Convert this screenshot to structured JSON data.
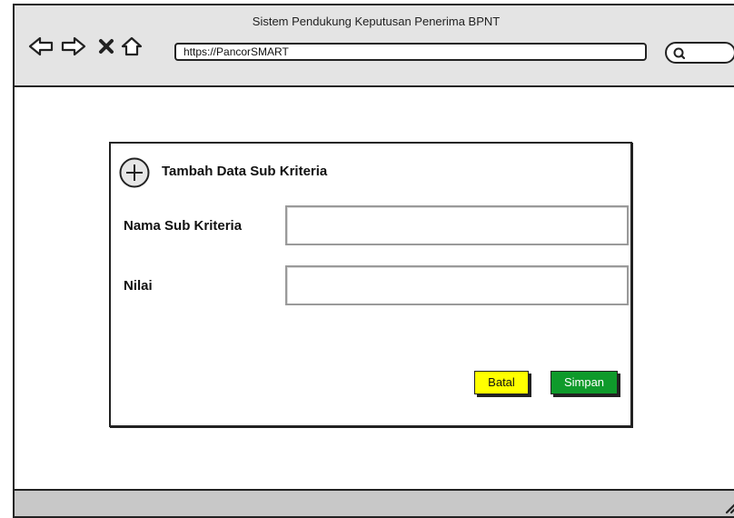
{
  "window": {
    "title": "Sistem Pendukung Keputusan Penerima BPNT",
    "url": "https://PancorSMART"
  },
  "nav_icons": [
    "back-arrow-icon",
    "forward-arrow-icon",
    "close-icon",
    "home-icon",
    "search-icon"
  ],
  "dialog": {
    "title": "Tambah Data Sub Kriteria",
    "fields": [
      {
        "label": "Nama Sub Kriteria",
        "value": ""
      },
      {
        "label": "Nilai",
        "value": ""
      }
    ],
    "buttons": {
      "cancel": "Batal",
      "save": "Simpan"
    }
  },
  "colors": {
    "cancel_bg": "#ffff00",
    "save_bg": "#0f9a2b",
    "chrome_bg": "#e4e4e4",
    "footer_bg": "#c8c8c8"
  }
}
